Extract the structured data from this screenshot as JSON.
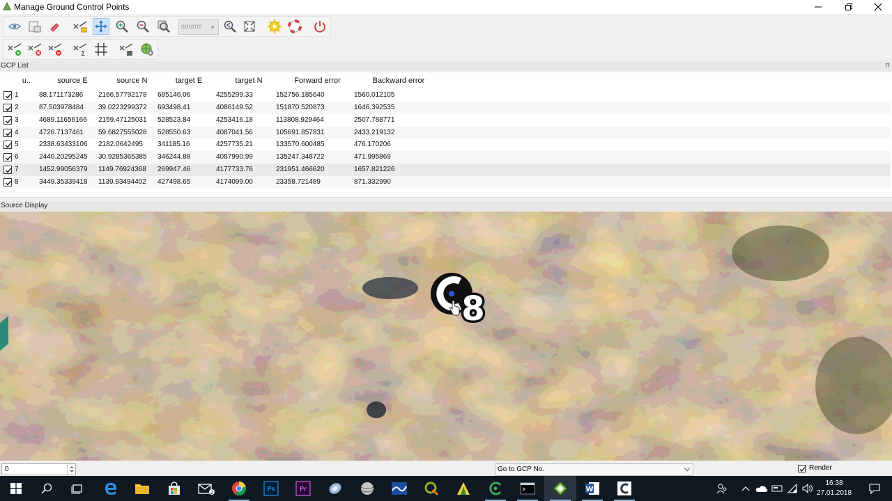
{
  "window": {
    "title": "Manage Ground Control Points"
  },
  "toolbar": {
    "source_combo_value": "source"
  },
  "gcp_list": {
    "header": "GCP List",
    "columns": [
      "u..",
      "source E",
      "source N",
      "target E",
      "target N",
      "Forward error",
      "Backward error"
    ],
    "rows": [
      {
        "id": "1",
        "sourceE": "88.171173286",
        "sourceN": "2166.57792178",
        "targetE": "685146.06",
        "targetN": "4255299.33",
        "forward": "152756.185640",
        "backward": "1560.012105",
        "checked": true
      },
      {
        "id": "2",
        "sourceE": "87.503978484",
        "sourceN": "39.0223299372",
        "targetE": "693498.41",
        "targetN": "4086149.52",
        "forward": "151870.520873",
        "backward": "1646.392535",
        "checked": true
      },
      {
        "id": "3",
        "sourceE": "4689.11656166",
        "sourceN": "2159.47125031",
        "targetE": "528523.84",
        "targetN": "4253416.18",
        "forward": "113808.929464",
        "backward": "2507.788771",
        "checked": true
      },
      {
        "id": "4",
        "sourceE": "4726.7137461",
        "sourceN": "59.6827555028",
        "targetE": "528550.63",
        "targetN": "4087041.56",
        "forward": "105691.857831",
        "backward": "2433.219132",
        "checked": true
      },
      {
        "id": "5",
        "sourceE": "2338.63433106",
        "sourceN": "2182.0642495",
        "targetE": "341185.16",
        "targetN": "4257735.21",
        "forward": "133570.600485",
        "backward": "476.170206",
        "checked": true
      },
      {
        "id": "6",
        "sourceE": "2440.20295245",
        "sourceN": "30.9285365385",
        "targetE": "346244.88",
        "targetN": "4087990.99",
        "forward": "135247.348722",
        "backward": "471.995869",
        "checked": true
      },
      {
        "id": "7",
        "sourceE": "1452.99056379",
        "sourceN": "1149.76924368",
        "targetE": "269947.46",
        "targetN": "4177733.76",
        "forward": "231951.466620",
        "backward": "1657.821226",
        "checked": true
      },
      {
        "id": "8",
        "sourceE": "3449.35339418",
        "sourceN": "1139.93494402",
        "targetE": "427498.65",
        "targetN": "4174099.00",
        "forward": "23358.721489",
        "backward": "871.332990",
        "checked": true
      }
    ]
  },
  "source_display": {
    "header": "Source Display",
    "marker_label": "8"
  },
  "status": {
    "spin_value": "0",
    "goto_placeholder": "Go to GCP No.",
    "render_label": "Render",
    "render_checked": true
  },
  "taskbar": {
    "time": "16:38",
    "date": "27.01.2018"
  },
  "colors": {
    "accent": "#0078d7",
    "taskbar": "#101922"
  }
}
